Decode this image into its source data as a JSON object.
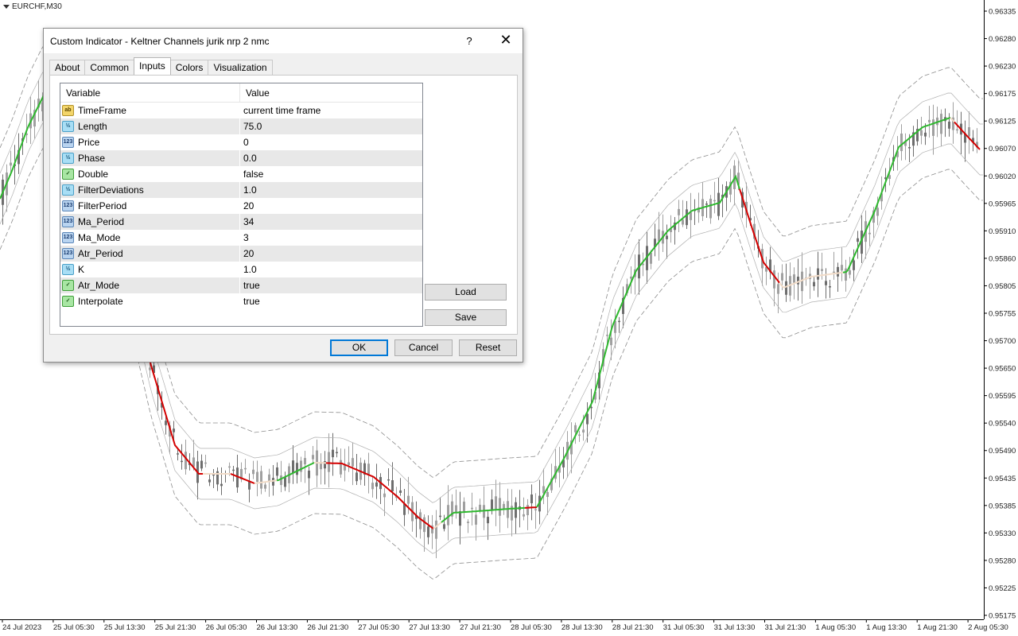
{
  "chart": {
    "symbol": "EURCHF,M30",
    "price_ticks": [
      "0.96335",
      "0.96280",
      "0.96230",
      "0.96175",
      "0.96125",
      "0.96070",
      "0.96020",
      "0.95965",
      "0.95910",
      "0.95860",
      "0.95805",
      "0.95755",
      "0.95700",
      "0.95650",
      "0.95595",
      "0.95540",
      "0.95490",
      "0.95435",
      "0.95385",
      "0.95330",
      "0.95280",
      "0.95225",
      "0.95175"
    ],
    "time_ticks": [
      "24 Jul 2023",
      "25 Jul 05:30",
      "25 Jul 13:30",
      "25 Jul 21:30",
      "26 Jul 05:30",
      "26 Jul 13:30",
      "26 Jul 21:30",
      "27 Jul 05:30",
      "27 Jul 13:30",
      "27 Jul 21:30",
      "28 Jul 05:30",
      "28 Jul 13:30",
      "28 Jul 21:30",
      "31 Jul 05:30",
      "31 Jul 13:30",
      "31 Jul 21:30",
      "1 Aug 05:30",
      "1 Aug 13:30",
      "1 Aug 21:30",
      "2 Aug 05:30"
    ],
    "colors": {
      "up": "#2eb82e",
      "down": "#d40000",
      "neutral": "#f2dcc8",
      "bar": "#a0a0a0",
      "band": "#8c8c8c"
    }
  },
  "dialog": {
    "title": "Custom Indicator - Keltner Channels jurik nrp 2 nmc",
    "help": "?",
    "close": "✕",
    "tabs": [
      "About",
      "Common",
      "Inputs",
      "Colors",
      "Visualization"
    ],
    "active_tab": "Inputs",
    "grid": {
      "col_variable": "Variable",
      "col_value": "Value",
      "rows": [
        {
          "icon": "str",
          "name": "TimeFrame",
          "value": "current time frame"
        },
        {
          "icon": "dbl",
          "name": "Length",
          "value": "75.0"
        },
        {
          "icon": "int",
          "name": "Price",
          "value": "0"
        },
        {
          "icon": "dbl",
          "name": "Phase",
          "value": "0.0"
        },
        {
          "icon": "bool",
          "name": "Double",
          "value": "false"
        },
        {
          "icon": "dbl",
          "name": "FilterDeviations",
          "value": "1.0"
        },
        {
          "icon": "int",
          "name": "FilterPeriod",
          "value": "20"
        },
        {
          "icon": "int",
          "name": "Ma_Period",
          "value": "34"
        },
        {
          "icon": "int",
          "name": "Ma_Mode",
          "value": "3"
        },
        {
          "icon": "int",
          "name": "Atr_Period",
          "value": "20"
        },
        {
          "icon": "dbl",
          "name": "K",
          "value": "1.0"
        },
        {
          "icon": "bool",
          "name": "Atr_Mode",
          "value": "true"
        },
        {
          "icon": "bool",
          "name": "Interpolate",
          "value": "true"
        }
      ]
    },
    "buttons": {
      "load": "Load",
      "save": "Save",
      "ok": "OK",
      "cancel": "Cancel",
      "reset": "Reset"
    }
  }
}
